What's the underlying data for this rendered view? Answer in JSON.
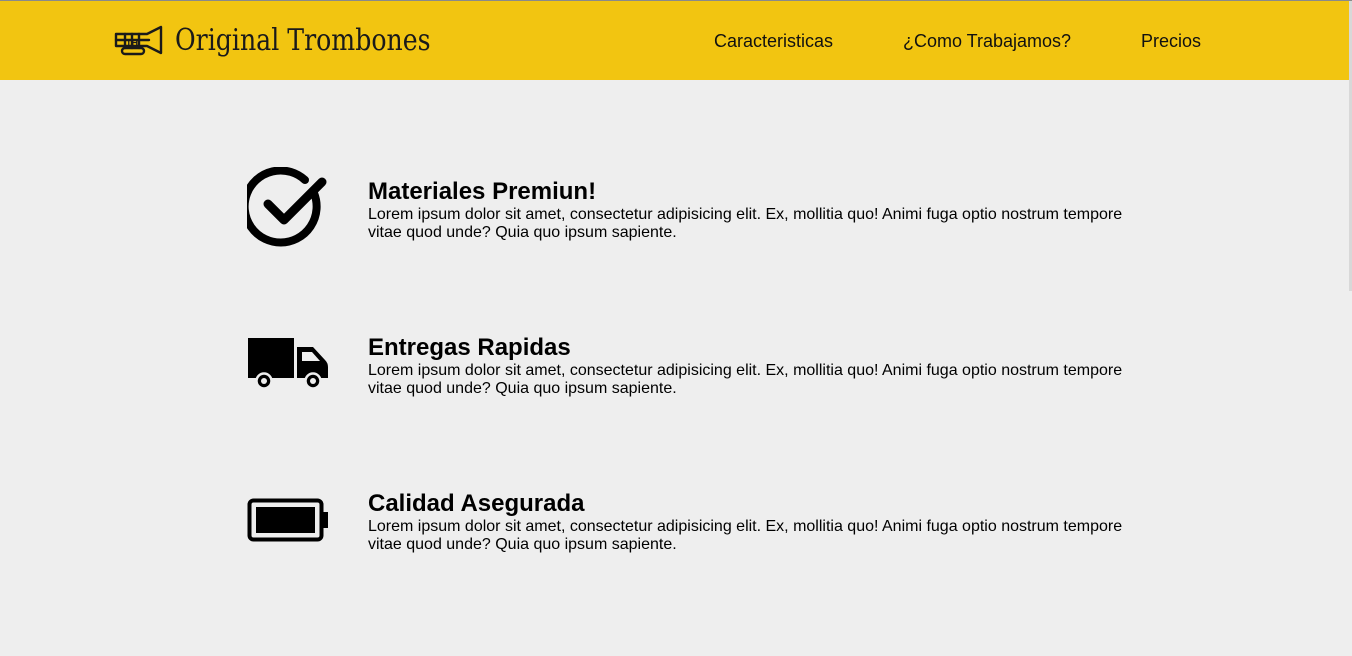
{
  "header": {
    "brand": "Original Trombones",
    "logo_icon": "trumpet-icon",
    "background": "#f2c511",
    "nav": [
      {
        "label": "Caracteristicas"
      },
      {
        "label": "¿Como Trabajamos?"
      },
      {
        "label": "Precios"
      }
    ]
  },
  "features": [
    {
      "icon": "check-circle-icon",
      "title": "Materiales Premiun!",
      "text": "Lorem ipsum dolor sit amet, consectetur adipisicing elit. Ex, mollitia quo! Animi fuga optio nostrum tempore vitae quod unde? Quia quo ipsum sapiente."
    },
    {
      "icon": "truck-icon",
      "title": "Entregas Rapidas",
      "text": "Lorem ipsum dolor sit amet, consectetur adipisicing elit. Ex, mollitia quo! Animi fuga optio nostrum tempore vitae quod unde? Quia quo ipsum sapiente."
    },
    {
      "icon": "battery-full-icon",
      "title": "Calidad Asegurada",
      "text": "Lorem ipsum dolor sit amet, consectetur adipisicing elit. Ex, mollitia quo! Animi fuga optio nostrum tempore vitae quod unde? Quia quo ipsum sapiente."
    }
  ],
  "colors": {
    "page_background": "#eeeeee",
    "text": "#000000"
  }
}
